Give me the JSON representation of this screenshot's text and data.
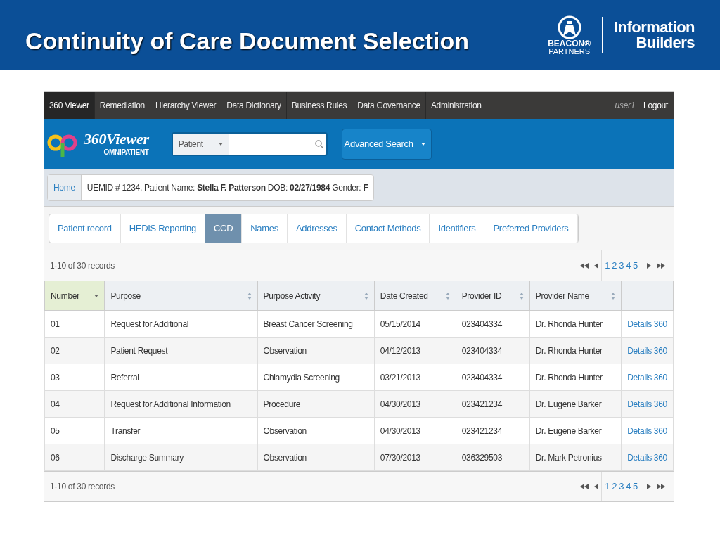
{
  "slide": {
    "title": "Continuity of Care Document Selection",
    "logos": [
      {
        "kind": "beacon",
        "lines": [
          "BEACON®",
          "PARTNERS"
        ]
      },
      {
        "kind": "ib",
        "lines": [
          "Information",
          "Builders"
        ]
      }
    ]
  },
  "nav": {
    "items": [
      {
        "label": "360 Viewer",
        "selected": true
      },
      {
        "label": "Remediation",
        "selected": false
      },
      {
        "label": "Hierarchy Viewer",
        "selected": false
      },
      {
        "label": "Data Dictionary",
        "selected": false
      },
      {
        "label": "Business Rules",
        "selected": false
      },
      {
        "label": "Data Governance",
        "selected": false
      },
      {
        "label": "Administration",
        "selected": false
      }
    ],
    "user": "user1",
    "logout": "Logout"
  },
  "header": {
    "logo": {
      "title": "360Viewer",
      "subtitle": "OMNIPATIENT"
    },
    "search_type": "Patient",
    "advanced_search": "Advanced Search"
  },
  "breadcrumb": {
    "home": "Home",
    "patient": "UEMID # 1234, Patient Name: **Stella F. Patterson** DOB: **02/27/1984** Gender: **F**"
  },
  "tabs": [
    {
      "label": "Patient record",
      "selected": false
    },
    {
      "label": "HEDIS Reporting",
      "selected": false
    },
    {
      "label": "CCD",
      "selected": true
    },
    {
      "label": "Names",
      "selected": false
    },
    {
      "label": "Addresses",
      "selected": false
    },
    {
      "label": "Contact Methods",
      "selected": false
    },
    {
      "label": "Identifiers",
      "selected": false
    },
    {
      "label": "Preferred Providers",
      "selected": false
    }
  ],
  "pager_top": {
    "summary": "1-10 of 30 records",
    "pages": [
      "1",
      "2",
      "3",
      "4",
      "5"
    ]
  },
  "table": {
    "columns": [
      {
        "label": "Number",
        "sorted": true
      },
      {
        "label": "Purpose",
        "sorted": false
      },
      {
        "label": "Purpose Activity",
        "sorted": false
      },
      {
        "label": "Date Created",
        "sorted": false
      },
      {
        "label": "Provider ID",
        "sorted": false
      },
      {
        "label": "Provider Name",
        "sorted": false
      }
    ],
    "rows": [
      {
        "cells": [
          "01",
          "Request for Additional",
          "Breast Cancer Screening",
          "05/15/2014",
          "023404334",
          "Dr. Rhonda Hunter"
        ],
        "link": "Details 360"
      },
      {
        "cells": [
          "02",
          "Patient Request",
          "Observation",
          "04/12/2013",
          "023404334",
          "Dr. Rhonda Hunter"
        ],
        "link": "Details 360"
      },
      {
        "cells": [
          "03",
          "Referral",
          "Chlamydia Screening",
          "03/21/2013",
          "023404334",
          "Dr. Rhonda Hunter"
        ],
        "link": "Details 360"
      },
      {
        "cells": [
          "04",
          "Request for Additional Information",
          "Procedure",
          "04/30/2013",
          "023421234",
          "Dr. Eugene Barker"
        ],
        "link": "Details 360"
      },
      {
        "cells": [
          "05",
          "Transfer",
          "Observation",
          "04/30/2013",
          "023421234",
          "Dr. Eugene Barker"
        ],
        "link": "Details 360"
      },
      {
        "cells": [
          "06",
          "Discharge Summary",
          "Observation",
          "07/30/2013",
          "036329503",
          "Dr. Mark Petronius"
        ],
        "link": "Details 360"
      }
    ]
  },
  "pager_bottom": {
    "summary": "1-10 of 30 records",
    "pages": [
      "1",
      "2",
      "3",
      "4",
      "5"
    ]
  }
}
